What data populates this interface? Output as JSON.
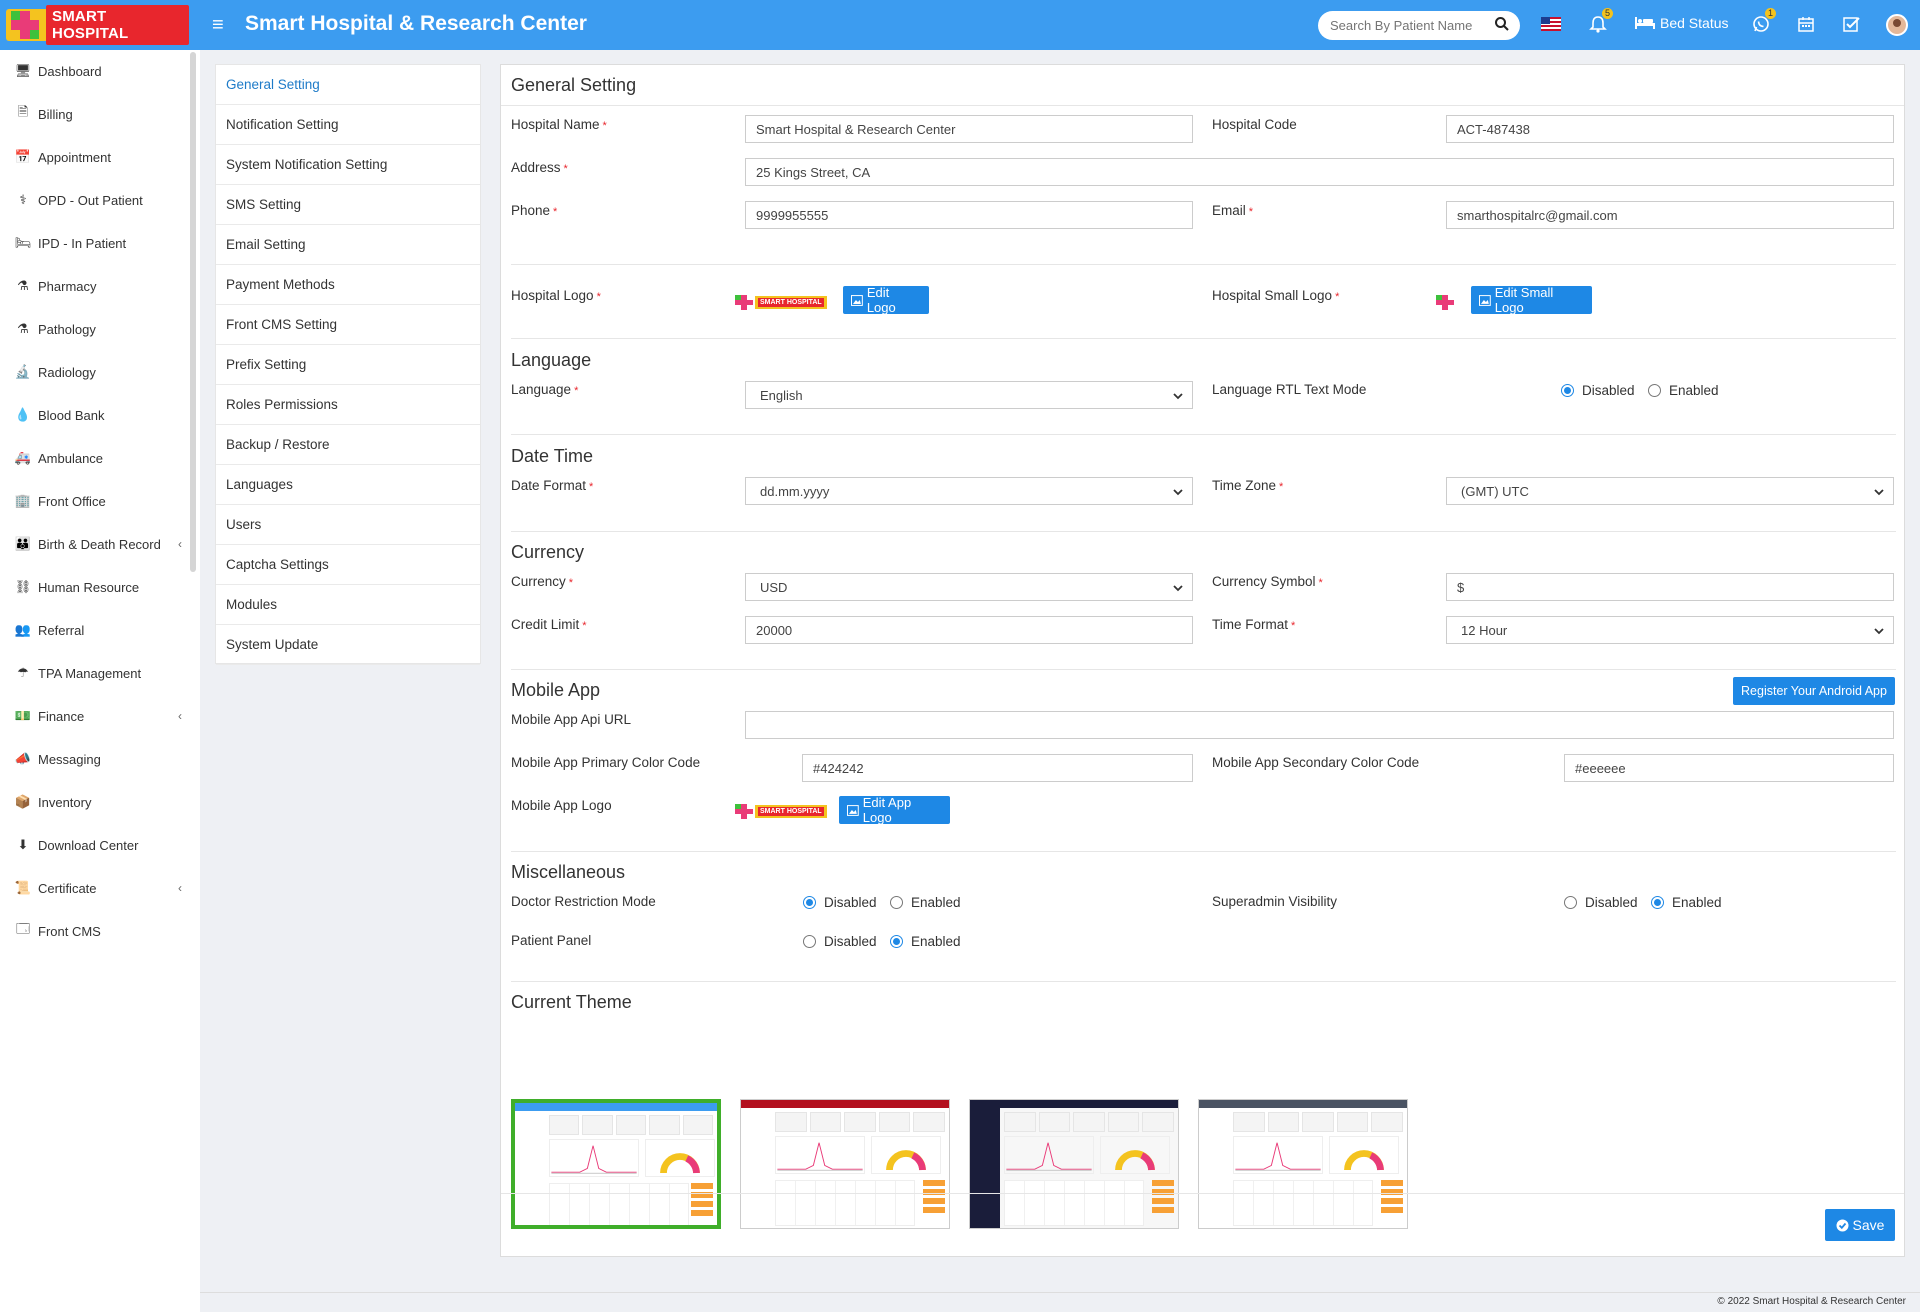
{
  "header": {
    "logo_text": "SMART HOSPITAL",
    "title": "Smart Hospital & Research Center",
    "search_placeholder": "Search By Patient Name",
    "notification_count": "5",
    "whatsapp_count": "1",
    "bed_status_label": "Bed Status",
    "accent_color": "#3c9cf0"
  },
  "leftnav": {
    "items": [
      {
        "label": "Dashboard",
        "icon": "monitor-icon",
        "glyph": "🖥"
      },
      {
        "label": "Billing",
        "icon": "billing-icon",
        "glyph": "🗎"
      },
      {
        "label": "Appointment",
        "icon": "calendar-check-icon",
        "glyph": "📅"
      },
      {
        "label": "OPD - Out Patient",
        "icon": "stethoscope-icon",
        "glyph": "⚕"
      },
      {
        "label": "IPD - In Patient",
        "icon": "bed-icon",
        "glyph": "🛏"
      },
      {
        "label": "Pharmacy",
        "icon": "mortar-pestle-icon",
        "glyph": "⚗"
      },
      {
        "label": "Pathology",
        "icon": "flask-icon",
        "glyph": "⚗"
      },
      {
        "label": "Radiology",
        "icon": "microscope-icon",
        "glyph": "🔬"
      },
      {
        "label": "Blood Bank",
        "icon": "tint-icon",
        "glyph": "💧"
      },
      {
        "label": "Ambulance",
        "icon": "ambulance-icon",
        "glyph": "🚑"
      },
      {
        "label": "Front Office",
        "icon": "building-icon",
        "glyph": "🏢"
      },
      {
        "label": "Birth & Death Record",
        "icon": "birth-death-icon",
        "glyph": "👪",
        "has_chevron": true
      },
      {
        "label": "Human Resource",
        "icon": "sitemap-icon",
        "glyph": "⛓"
      },
      {
        "label": "Referral",
        "icon": "users-icon",
        "glyph": "👥"
      },
      {
        "label": "TPA Management",
        "icon": "umbrella-icon",
        "glyph": "☂"
      },
      {
        "label": "Finance",
        "icon": "money-icon",
        "glyph": "💵",
        "has_chevron": true
      },
      {
        "label": "Messaging",
        "icon": "bullhorn-icon",
        "glyph": "📣"
      },
      {
        "label": "Inventory",
        "icon": "inventory-icon",
        "glyph": "📦"
      },
      {
        "label": "Download Center",
        "icon": "download-icon",
        "glyph": "⬇"
      },
      {
        "label": "Certificate",
        "icon": "certificate-icon",
        "glyph": "📜",
        "has_chevron": true
      },
      {
        "label": "Front CMS",
        "icon": "cms-icon",
        "glyph": "🗔"
      }
    ]
  },
  "submenu": {
    "items": [
      "General Setting",
      "Notification Setting",
      "System Notification Setting",
      "SMS Setting",
      "Email Setting",
      "Payment Methods",
      "Front CMS Setting",
      "Prefix Setting",
      "Roles Permissions",
      "Backup / Restore",
      "Languages",
      "Users",
      "Captcha Settings",
      "Modules",
      "System Update"
    ],
    "active": "General Setting"
  },
  "general": {
    "title": "General Setting",
    "hospital_name_label": "Hospital Name",
    "hospital_name": "Smart Hospital & Research Center",
    "hospital_code_label": "Hospital Code",
    "hospital_code": "ACT-487438",
    "address_label": "Address",
    "address": "25 Kings Street, CA",
    "phone_label": "Phone",
    "phone": "9999955555",
    "email_label": "Email",
    "email": "smarthospitalrc@gmail.com",
    "hospital_logo_label": "Hospital Logo",
    "edit_logo": "Edit Logo",
    "small_logo_label": "Hospital Small Logo",
    "edit_small_logo": "Edit Small Logo"
  },
  "language": {
    "title": "Language",
    "language_label": "Language",
    "language_value": "English",
    "rtl_label": "Language RTL Text Mode",
    "disabled": "Disabled",
    "enabled": "Enabled",
    "rtl_selected": "Disabled"
  },
  "datetime": {
    "title": "Date Time",
    "date_format_label": "Date Format",
    "date_format": "dd.mm.yyyy",
    "timezone_label": "Time Zone",
    "timezone": "(GMT) UTC"
  },
  "currency": {
    "title": "Currency",
    "currency_label": "Currency",
    "currency": "USD",
    "symbol_label": "Currency Symbol",
    "symbol": "$",
    "credit_limit_label": "Credit Limit",
    "credit_limit": "20000",
    "time_format_label": "Time Format",
    "time_format": "12 Hour"
  },
  "mobile": {
    "title": "Mobile App",
    "register_button": "Register Your Android App",
    "api_url_label": "Mobile App Api URL",
    "api_url": "",
    "primary_label": "Mobile App Primary Color Code",
    "primary": "#424242",
    "secondary_label": "Mobile App Secondary Color Code",
    "secondary": "#eeeeee",
    "logo_label": "Mobile App Logo",
    "edit_app_logo": "Edit App Logo"
  },
  "misc": {
    "title": "Miscellaneous",
    "doctor_label": "Doctor Restriction Mode",
    "doctor_selected": "Disabled",
    "superadmin_label": "Superadmin Visibility",
    "superadmin_selected": "Enabled",
    "patient_label": "Patient Panel",
    "patient_selected": "Enabled",
    "disabled": "Disabled",
    "enabled": "Enabled"
  },
  "theme": {
    "title": "Current Theme",
    "options": [
      {
        "name": "default",
        "topbar": "#3c9cf0",
        "sidebar": "#ffffff",
        "selected": true
      },
      {
        "name": "red",
        "topbar": "#b3101f",
        "sidebar": "#ffffff",
        "selected": false
      },
      {
        "name": "blue-dark",
        "topbar": "#1a1d3a",
        "sidebar": "#1a1d3a",
        "selected": false
      },
      {
        "name": "gray",
        "topbar": "#4a5363",
        "sidebar": "#ffffff",
        "selected": false
      }
    ]
  },
  "save_button": "Save",
  "footer": "© 2022 Smart Hospital & Research Center"
}
